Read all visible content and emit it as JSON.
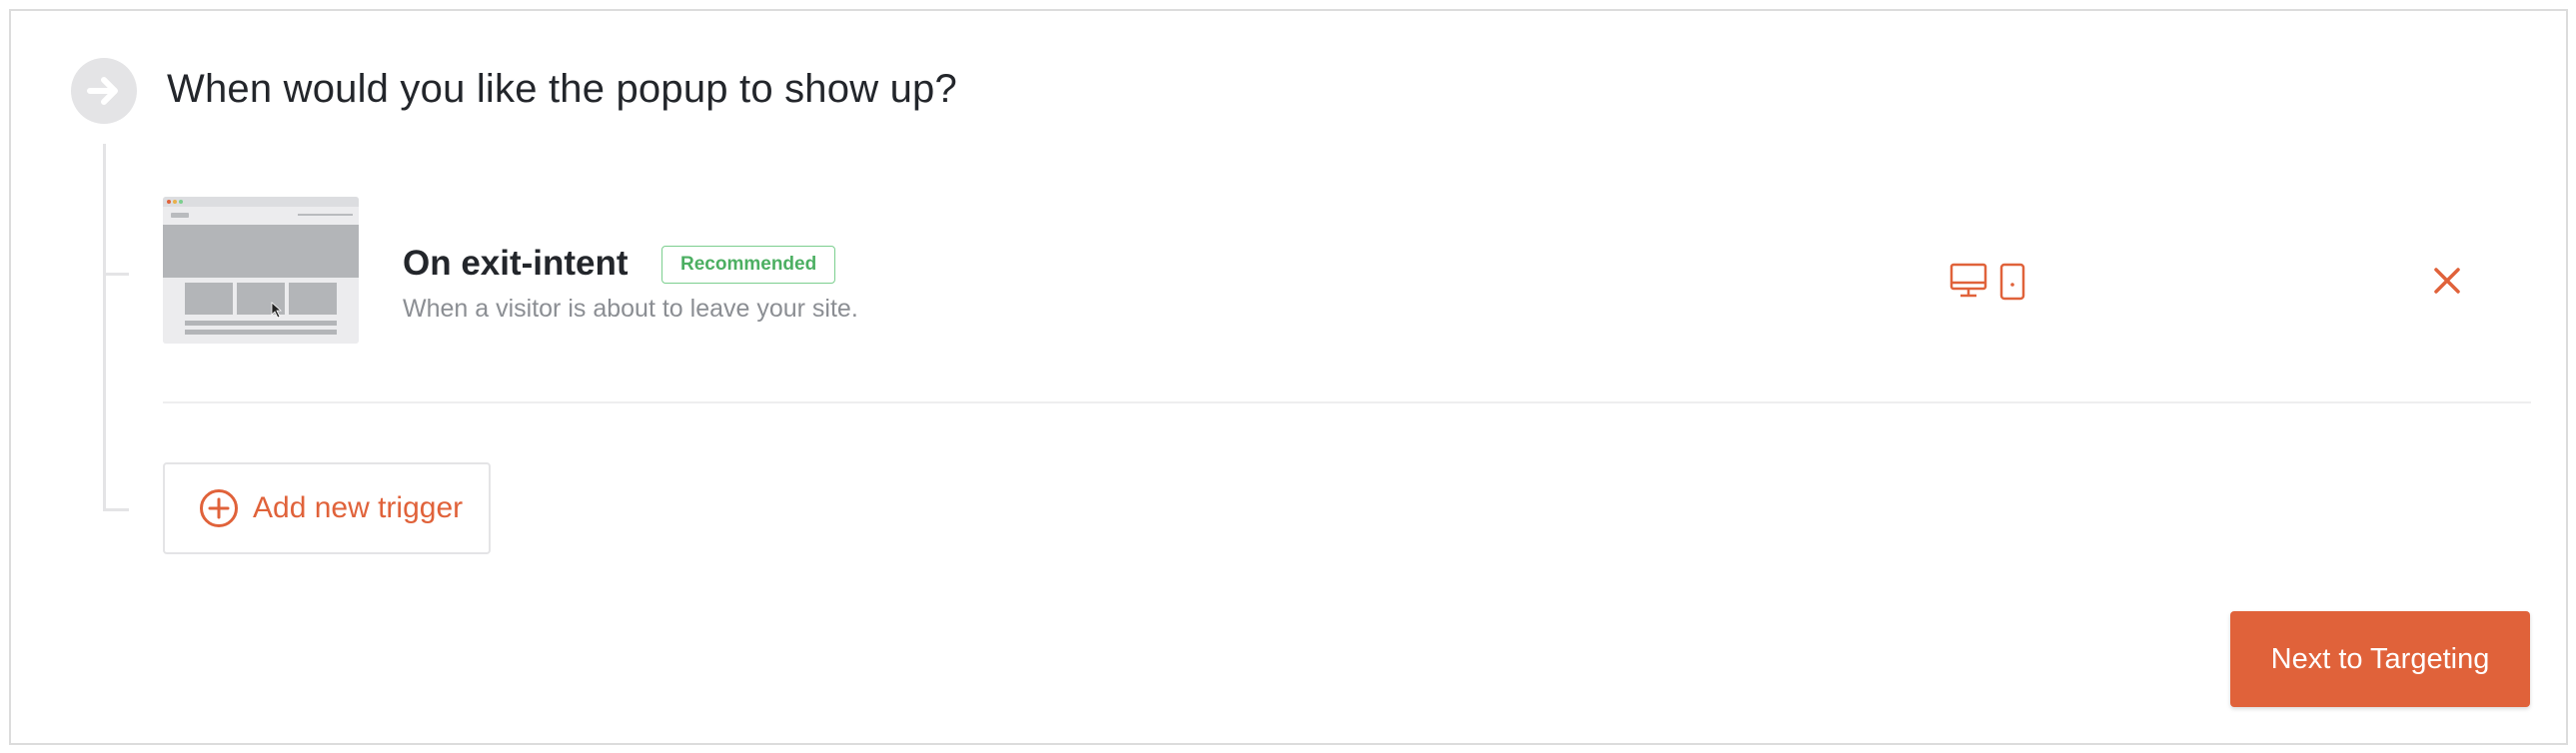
{
  "step": {
    "title": "When would you like the popup to show up?",
    "icon": "arrow-right-icon"
  },
  "trigger": {
    "title": "On exit-intent",
    "badge": "Recommended",
    "description": "When a visitor is about to leave your site.",
    "devices": [
      "desktop-icon",
      "mobile-icon"
    ],
    "remove_icon": "close-icon"
  },
  "add_trigger": {
    "label": "Add new trigger",
    "icon": "plus-circle-icon"
  },
  "footer": {
    "next_label": "Next to Targeting"
  },
  "colors": {
    "accent": "#e0623a",
    "badge_green": "#4caf62",
    "muted": "#8b8e93"
  }
}
